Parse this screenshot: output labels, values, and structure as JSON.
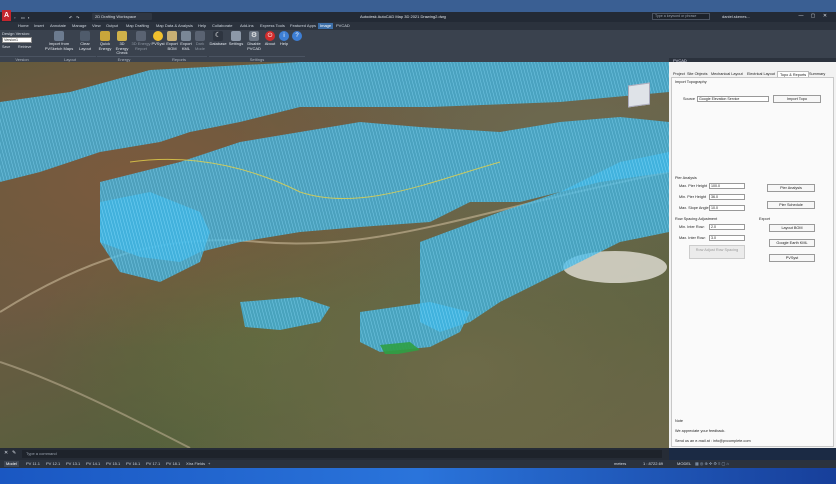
{
  "window": {
    "title": "Autodesk AutoCAD Map 3D 2021  Drawing2.dwg",
    "workspace": "2D Drafting Workspace",
    "search_placeholder": "Type a keyword or phrase",
    "user": "daniel.skenes..."
  },
  "ribbon": {
    "tabs": [
      "Home",
      "Insert",
      "Annotate",
      "Manage",
      "View",
      "Output",
      "Map Drafting",
      "Map Data & Analysis",
      "Help",
      "Collaborate",
      "Add-ins",
      "Express Tools",
      "Featured Apps",
      "Image",
      "PVCAD"
    ],
    "active_tab": "Image",
    "groups": [
      {
        "title": "Version",
        "items": [
          "Design Version:",
          "Version1",
          "Save",
          "Retrieve"
        ]
      },
      {
        "title": "Layout",
        "items": [
          "Import from PVSketch Maps",
          "Clear Layout"
        ]
      },
      {
        "title": "Energy",
        "items": [
          "Quick Energy",
          "3D Energy Check",
          "3D Energy Report"
        ]
      },
      {
        "title": "Reports",
        "items": [
          "PVSyst",
          "Export BOM",
          "Export KML",
          "Dark Mode"
        ]
      },
      {
        "title": "Settings",
        "items": [
          "Database",
          "Settings",
          "Disable PVCAD",
          "About",
          "Help"
        ]
      }
    ]
  },
  "panel": {
    "title": "PVCAD",
    "tabs": [
      "Project",
      "Site Objects",
      "Mechanical Layout",
      "Electrical Layout",
      "Topo & Reports",
      "Summary"
    ],
    "active_tab": "Topo & Reports",
    "import_topo": {
      "header": "Import Topography",
      "source_label": "Source",
      "source_value": "Google Elevation Service",
      "button": "Import Topo"
    },
    "pier": {
      "header": "Pier Analysis",
      "max_pier_label": "Max. Pier Height",
      "max_pier": "100.0",
      "min_pier_label": "Min. Pier Height",
      "min_pier": "36.0",
      "max_slope_label": "Max. Slope Angle",
      "max_slope": "10.0",
      "analysis_button": "Pier Analysis",
      "schedule_button": "Pier Schedule"
    },
    "row": {
      "header": "Row Spacing Adjustment",
      "min_label": "Min. Inter Row:",
      "min_value": "2.0",
      "max_label": "Max. Inter Row:",
      "max_value": "3.0",
      "button": "Row Adjust Row Spacing"
    },
    "export": {
      "header": "Export",
      "layout_bom": "Layout BOM",
      "kml": "Google Earth KML",
      "pvsyst": "PVSyst"
    },
    "note": {
      "header": "Note",
      "line1": "We appreciate your feedback.",
      "line2": "Send us an e-mail at : info@pvcomplete.com"
    }
  },
  "command": {
    "placeholder": "Type a command"
  },
  "status": {
    "layout_tabs": [
      "Model",
      "PV 11.1",
      "PV 12.1",
      "PV 13.1",
      "PV 14.1",
      "PV 15.1",
      "PV 16.1",
      "PV 17.1",
      "PV 18.1",
      "Xtra Fields"
    ],
    "active": "Model",
    "coords": "1 : 8722.69",
    "units": "meters",
    "mode": "MODEL"
  },
  "colors": {
    "accent": "#3d6fa8",
    "array_fill": "#3fb6e6"
  }
}
